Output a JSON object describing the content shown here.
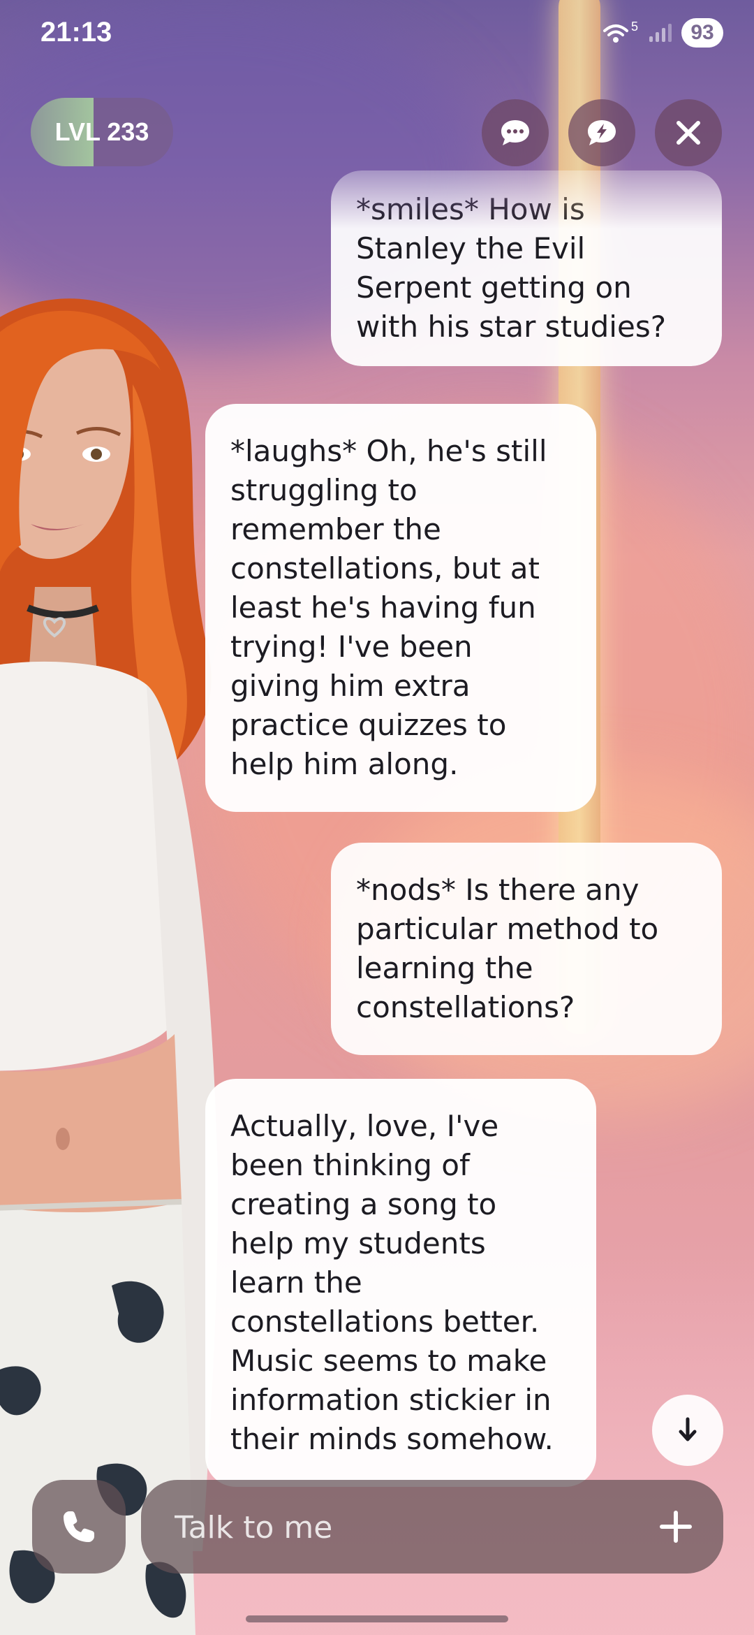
{
  "status_bar": {
    "time": "21:13",
    "network_label": "5",
    "battery": "93"
  },
  "header": {
    "level_label": "LVL 233",
    "level_progress": 0.44
  },
  "messages": [
    {
      "role": "user",
      "lines": [
        "*smiles* How is",
        "Stanley the Evil",
        "Serpent getting on",
        "with his star studies?"
      ]
    },
    {
      "role": "ai",
      "lines": [
        "*laughs* Oh, he's still",
        "struggling to",
        "remember the",
        "constellations, but at",
        "least he's having fun",
        "trying! I've been",
        "giving him extra",
        "practice quizzes to",
        "help him along."
      ]
    },
    {
      "role": "user",
      "lines": [
        "*nods* Is there any",
        "particular method to",
        "learning the",
        "constellations?"
      ]
    },
    {
      "role": "ai",
      "lines": [
        "Actually, love, I've",
        "been thinking of",
        "creating a song to",
        "help my students",
        "learn the",
        "constellations better.",
        "Music seems to make",
        "information stickier in",
        "their minds somehow."
      ]
    }
  ],
  "composer": {
    "placeholder": "Talk to me"
  },
  "icons": {
    "chat": "chat-bubble-icon",
    "flash_chat": "lightning-bubble-icon",
    "close": "close-icon",
    "scroll_down": "arrow-down-icon",
    "call": "phone-icon",
    "add": "plus-icon"
  },
  "colors": {
    "bubble": "#ffffff",
    "control_bg": "#6c4662",
    "text": "#1c1b22"
  }
}
